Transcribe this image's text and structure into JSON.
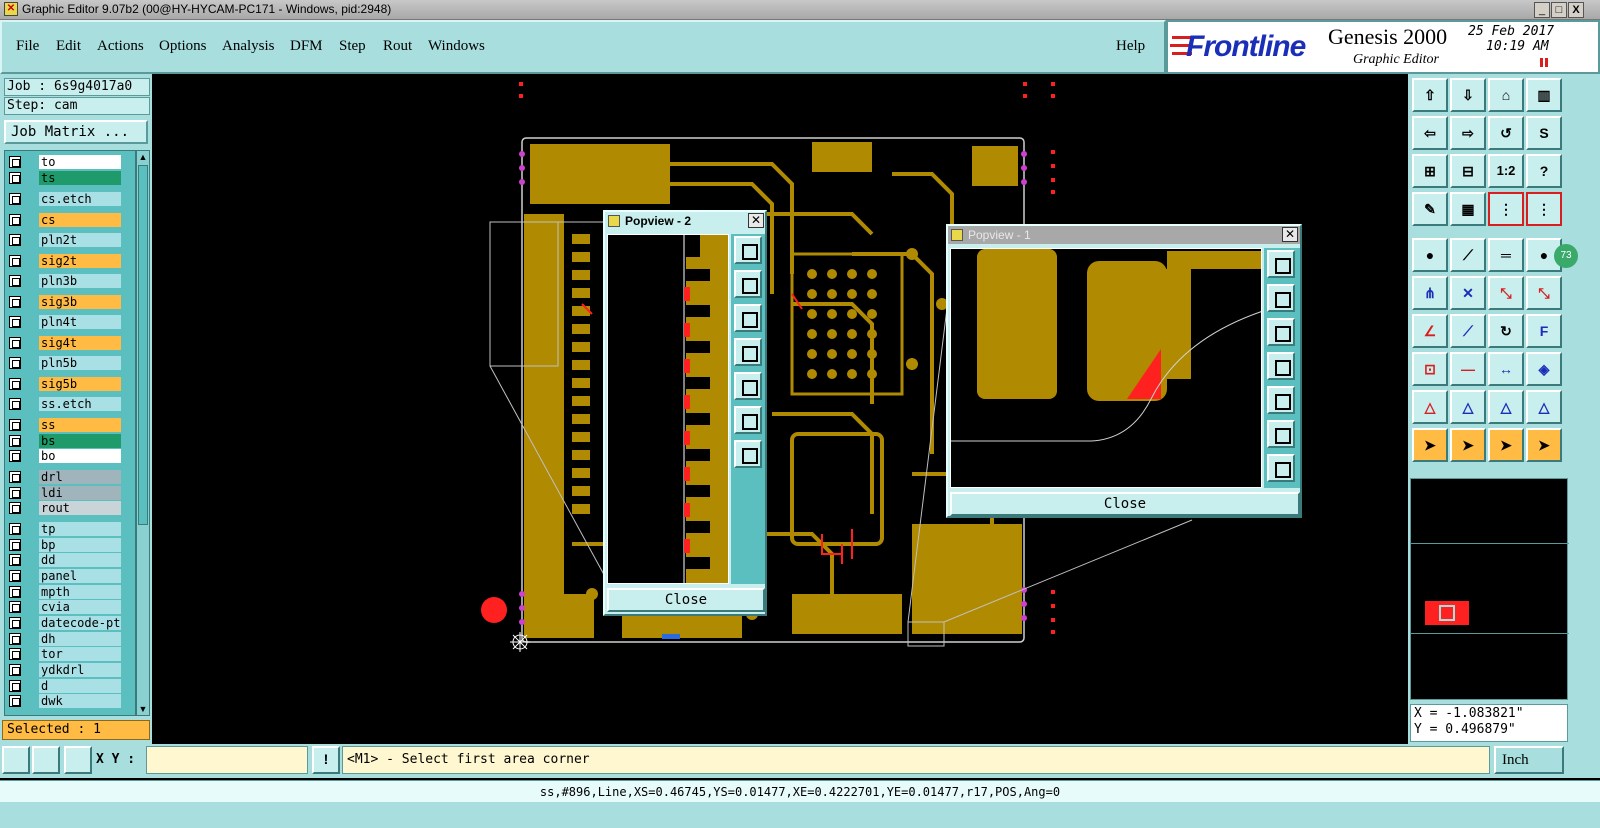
{
  "window": {
    "title": "Graphic Editor 9.07b2 (00@HY-HYCAM-PC171 - Windows, pid:2948)",
    "minimize": "_",
    "maximize": "□",
    "close": "X"
  },
  "menu": {
    "items": [
      "File",
      "Edit",
      "Actions",
      "Options",
      "Analysis",
      "DFM",
      "Step",
      "Rout",
      "Windows"
    ],
    "help": "Help"
  },
  "brand": {
    "logo": "Frontline",
    "product": "Genesis 2000",
    "subtitle": "Graphic Editor",
    "date": "25 Feb 2017",
    "time": "10:19 AM"
  },
  "job": {
    "job_line": "Job : 6s9g4017a0",
    "step_line": "Step: cam",
    "job_matrix": "Job Matrix ..."
  },
  "layers": [
    {
      "name": "to",
      "color": "#ffffff"
    },
    {
      "name": "ts",
      "color": "#1f9a6a"
    },
    {
      "name": "cs.etch",
      "color": "#a8e0e6"
    },
    {
      "name": "cs",
      "color": "#ffbb44"
    },
    {
      "name": "pln2t",
      "color": "#a8e0e6"
    },
    {
      "name": "sig2t",
      "color": "#ffbb44"
    },
    {
      "name": "pln3b",
      "color": "#a8e0e6"
    },
    {
      "name": "sig3b",
      "color": "#ffbb44"
    },
    {
      "name": "pln4t",
      "color": "#a8e0e6"
    },
    {
      "name": "sig4t",
      "color": "#ffbb44"
    },
    {
      "name": "pln5b",
      "color": "#a8e0e6"
    },
    {
      "name": "sig5b",
      "color": "#ffbb44"
    },
    {
      "name": "ss.etch",
      "color": "#a8e0e6"
    },
    {
      "name": "ss",
      "color": "#ffbb44"
    },
    {
      "name": "bs",
      "color": "#1f9a6a"
    },
    {
      "name": "bo",
      "color": "#ffffff"
    },
    {
      "name": "drl",
      "color": "#a0b4bc"
    },
    {
      "name": "ldi",
      "color": "#a0b4bc"
    },
    {
      "name": "rout",
      "color": "#c8d4d8"
    },
    {
      "name": "tp",
      "color": "#a8e0e6"
    },
    {
      "name": "bp",
      "color": "#a8e0e6"
    },
    {
      "name": "dd",
      "color": "#a8e0e6"
    },
    {
      "name": "panel",
      "color": "#a8e0e6"
    },
    {
      "name": "mpth",
      "color": "#a8e0e6"
    },
    {
      "name": "cvia",
      "color": "#a8e0e6"
    },
    {
      "name": "datecode-pte",
      "color": "#a8e0e6"
    },
    {
      "name": "dh",
      "color": "#a8e0e6"
    },
    {
      "name": "tor",
      "color": "#a8e0e6"
    },
    {
      "name": "ydkdrl",
      "color": "#a8e0e6"
    },
    {
      "name": "d",
      "color": "#a8e0e6"
    },
    {
      "name": "dwk",
      "color": "#a8e0e6"
    }
  ],
  "selected": "Selected : 1",
  "popview2": {
    "title": "Popview - 2",
    "close": "Close"
  },
  "popview1": {
    "title": "Popview - 1",
    "close": "Close"
  },
  "toolbar_text": {
    "ratio": "1:2",
    "help": "?",
    "badge": "73"
  },
  "coords": {
    "x": "X = -1.083821\"",
    "y": "Y =  0.496879\""
  },
  "bottom": {
    "xy_label": "X Y :",
    "xy_value": "",
    "prompt": "<M1> - Select first area corner",
    "units": "Inch",
    "status": "ss,#896,Line,XS=0.46745,YS=0.01477,XE=0.4222701,YE=0.01477,r17,POS,Ang=0"
  },
  "colors": {
    "copper": "#b08a00",
    "panel": "#a8dede",
    "highlight": "#ff2020",
    "via_marker": "#d040d0"
  }
}
